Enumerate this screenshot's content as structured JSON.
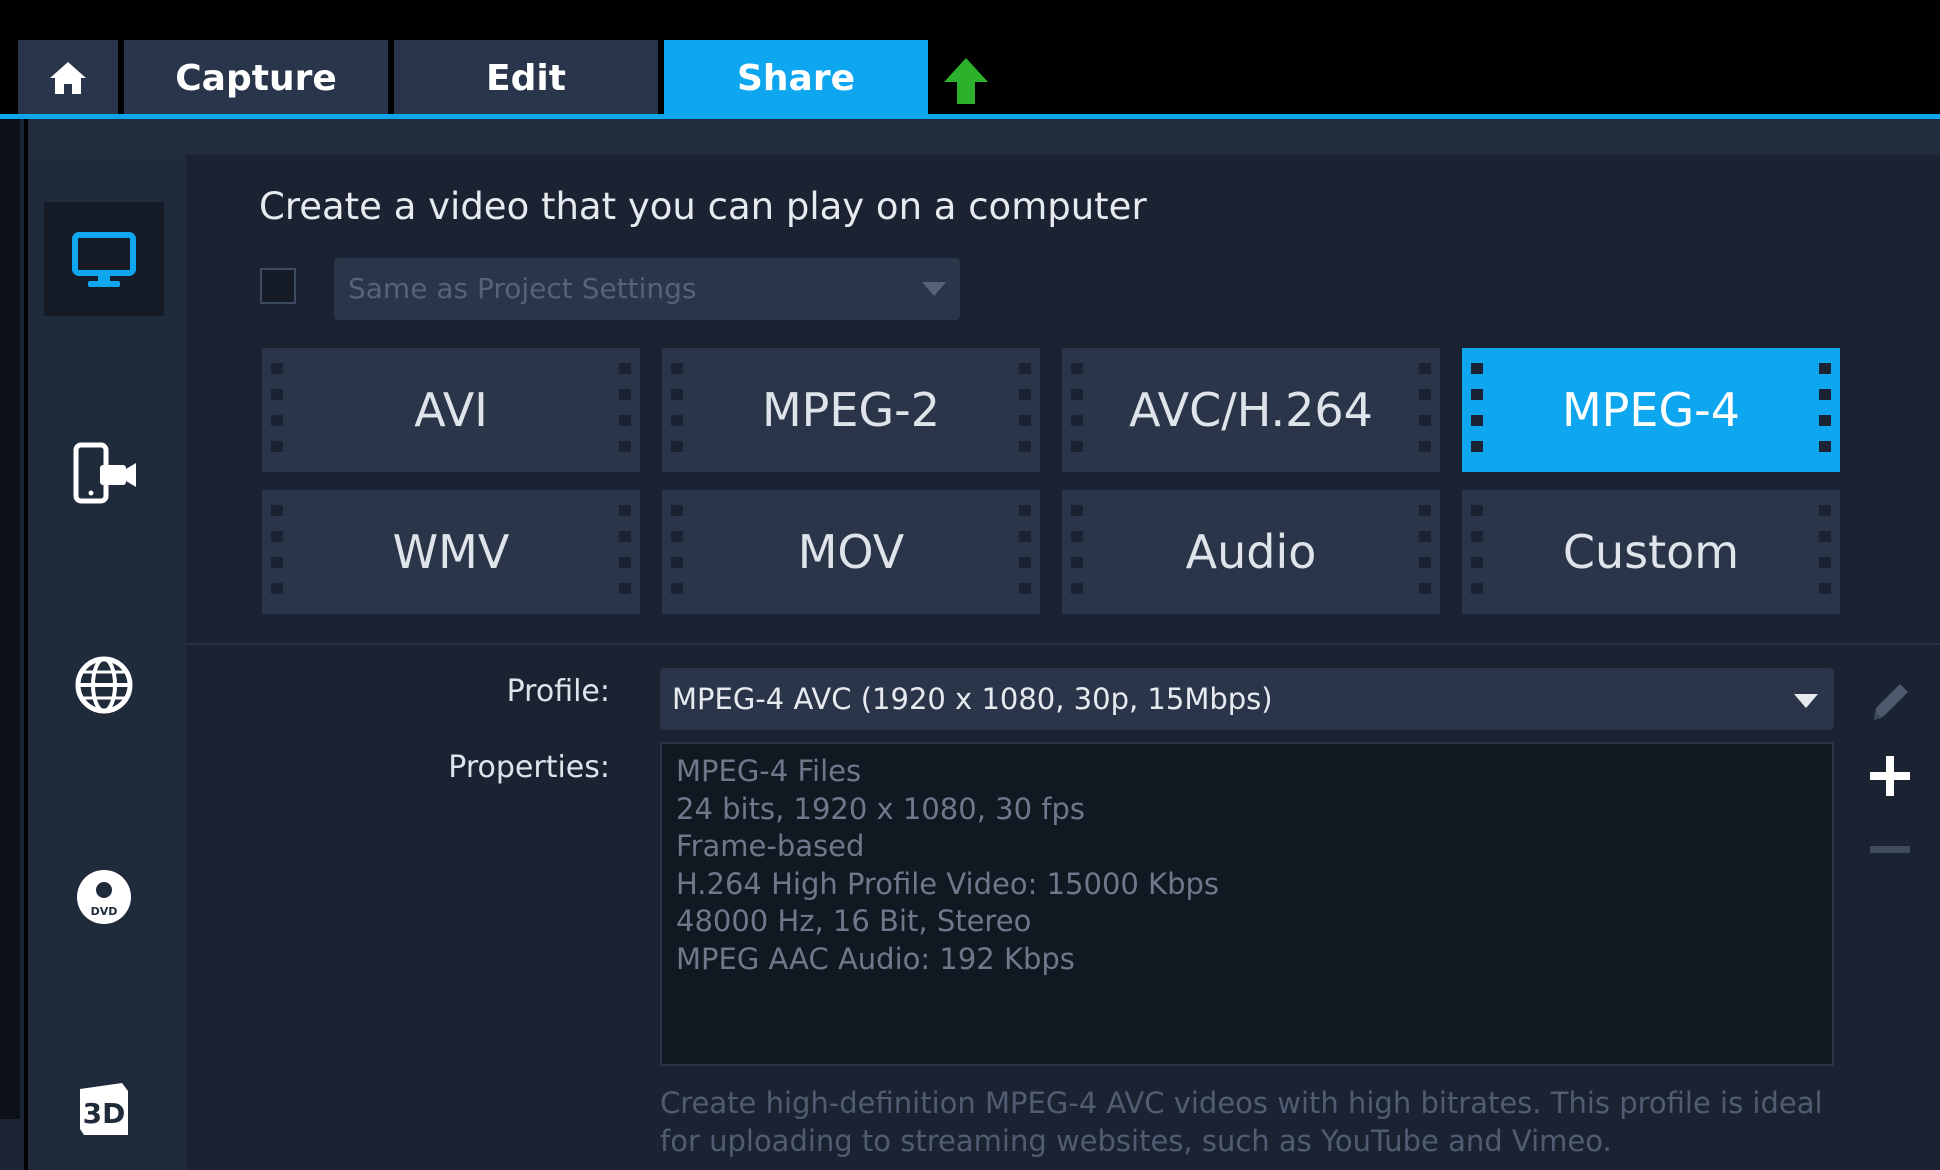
{
  "tabs": [
    {
      "label": "",
      "icon": "home-icon"
    },
    {
      "label": "Capture"
    },
    {
      "label": "Edit"
    },
    {
      "label": "Share",
      "active": true
    }
  ],
  "upload_icon": "upload-arrow-icon",
  "sidebar": {
    "items": [
      {
        "icon": "computer-monitor-icon",
        "active": true
      },
      {
        "icon": "mobile-device-icon"
      },
      {
        "icon": "globe-icon"
      },
      {
        "icon": "dvd-disc-icon"
      },
      {
        "icon": "3d-icon",
        "text": "3D"
      }
    ]
  },
  "main": {
    "heading": "Create a video that you can play on a computer",
    "same_as_project_checked": false,
    "same_as_project_label": "Same as Project Settings"
  },
  "formats": [
    {
      "label": "AVI"
    },
    {
      "label": "MPEG-2"
    },
    {
      "label": "AVC/H.264"
    },
    {
      "label": "MPEG-4",
      "active": true
    },
    {
      "label": "WMV"
    },
    {
      "label": "MOV"
    },
    {
      "label": "Audio"
    },
    {
      "label": "Custom"
    }
  ],
  "profile": {
    "label": "Profile:",
    "value": "MPEG-4 AVC (1920 x 1080, 30p, 15Mbps)"
  },
  "properties": {
    "label": "Properties:",
    "lines": [
      "MPEG-4 Files",
      "24 bits, 1920 x 1080, 30 fps",
      "Frame-based",
      "H.264 High Profile Video: 15000 Kbps",
      "48000 Hz, 16 Bit, Stereo",
      "MPEG AAC Audio: 192 Kbps"
    ]
  },
  "description": "Create high-definition MPEG-4 AVC videos with high bitrates. This profile is ideal for uploading to streaming websites, such as YouTube and Vimeo.",
  "tools": [
    "edit-pencil-icon",
    "add-plus-icon",
    "remove-minus-icon"
  ],
  "colors": {
    "accent": "#0da6ef",
    "panel": "#1b2333",
    "tile": "#2a3549",
    "upload_green": "#2db12d"
  }
}
